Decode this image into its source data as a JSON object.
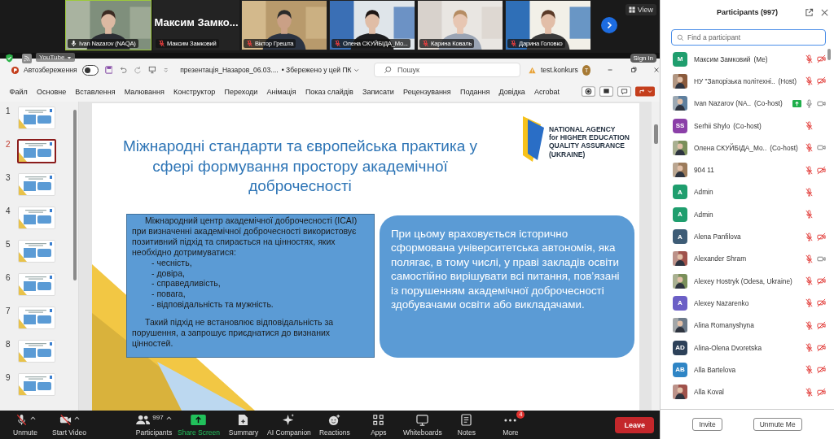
{
  "meeting_strip": {
    "tiles": [
      {
        "kind": "video",
        "name": "Ivan Nazarov (NAQA)",
        "muted": false,
        "active_speaker": true
      },
      {
        "kind": "name",
        "display_name": "Максим Замко...",
        "name": "Максим Замковий",
        "muted": true,
        "active_speaker": false
      },
      {
        "kind": "video",
        "name": "Віктор Грешта",
        "muted": true,
        "active_speaker": false
      },
      {
        "kind": "video",
        "name": "Олена СКУЙБІДА_Мо...",
        "muted": true,
        "active_speaker": false
      },
      {
        "kind": "video",
        "name": "Карина Коваль",
        "muted": true,
        "active_speaker": false
      },
      {
        "kind": "video",
        "name": "Дарина Головко",
        "muted": true,
        "active_speaker": false
      }
    ],
    "view_button": "View"
  },
  "browser_overlay": {
    "extension_chip": "YouTube",
    "sign_in": "Sign in"
  },
  "powerpoint": {
    "autosave_label": "Автозбереження",
    "autosave_on": false,
    "file_name": "презентація_Назаров_06.03....",
    "save_status": "• Збережено у цей ПК",
    "search_placeholder": "Пошук",
    "account": "test.konkurs",
    "account_initial": "T",
    "ribbon_tabs": [
      "Файл",
      "Основне",
      "Вставлення",
      "Малювання",
      "Конструктор",
      "Переходи",
      "Анімація",
      "Показ слайдів",
      "Записати",
      "Рецензування",
      "Подання",
      "Довідка",
      "Acrobat"
    ],
    "slides": [
      {
        "number": "1",
        "selected": false
      },
      {
        "number": "2",
        "selected": true
      },
      {
        "number": "3",
        "selected": false
      },
      {
        "number": "4",
        "selected": false
      },
      {
        "number": "5",
        "selected": false
      },
      {
        "number": "6",
        "selected": false
      },
      {
        "number": "7",
        "selected": false
      },
      {
        "number": "8",
        "selected": false
      },
      {
        "number": "9",
        "selected": false
      }
    ],
    "current_slide": {
      "title": "Міжнародні стандарти та європейська практика у сфері формування простору академічної доброчесності",
      "logo_lines": [
        "NATIONAL AGENCY",
        "for HIGHER EDUCATION",
        "QUALITY ASSURANCE",
        "(UKRAINE)"
      ],
      "left_box": {
        "paragraph": "Міжнародний центр академічної доброчесності (ICAI) при визначенні академічної доброчесності використовує позитивний підхід та спирається на цінностях, яких необхідно дотримуватися:",
        "bullets": [
          "- чесність,",
          "- довіра,",
          "- справедливість,",
          "- повага,",
          "- відповідальність та мужність."
        ],
        "closing": "Такий підхід не встановлює відповідальність за порушення, а запрошує приєднатися до визнаних цінностей."
      },
      "right_box": {
        "text": "При цьому враховується історично сформована університетська автономія, яка полягає, в тому числі, у праві закладів освіти самостійно вирішувати всі питання, пов’язані із порушенням академічної доброчесності здобувачами освіти або викладачами."
      }
    }
  },
  "participants": {
    "title": "Participants (997)",
    "search_placeholder": "Find a participant",
    "rows": [
      {
        "name": "Максим Замковий",
        "role": "(Me)",
        "avatar": {
          "kind": "initials",
          "text": "M",
          "color": "#1f9e6e"
        },
        "muted": true,
        "video_on": false,
        "sharing": false
      },
      {
        "name": "НУ \"Запорізька політехні..",
        "role": "(Host)",
        "muted": true,
        "video_on": false,
        "sharing": false
      },
      {
        "name": "Ivan Nazarov (NA..",
        "role": "(Co-host)",
        "muted": false,
        "video_on": true,
        "sharing": true
      },
      {
        "name": "Serhii Shylo",
        "role": "(Co-host)",
        "avatar": {
          "kind": "initials",
          "text": "SS",
          "color": "#8b3fa8"
        },
        "muted": true,
        "sharing": false
      },
      {
        "name": "Олена СКУЙБІДА_Мо..",
        "role": "(Co-host)",
        "muted": true,
        "video_on": true,
        "sharing": false
      },
      {
        "name": "904 11",
        "muted": true,
        "video_on": false,
        "sharing": false
      },
      {
        "name": "Admin",
        "avatar": {
          "kind": "initials",
          "text": "A",
          "color": "#1f9e6e"
        },
        "muted": true,
        "sharing": false
      },
      {
        "name": "Admin",
        "avatar": {
          "kind": "initials",
          "text": "A",
          "color": "#1f9e6e"
        },
        "muted": true,
        "sharing": false
      },
      {
        "name": "Alena Panfilova",
        "avatar": {
          "kind": "initials",
          "text": "A",
          "color": "#3e5c76"
        },
        "muted": true,
        "video_on": false,
        "sharing": false
      },
      {
        "name": "Alexander Shram",
        "muted": true,
        "video_on": true,
        "sharing": false
      },
      {
        "name": "Alexey Hostryk (Odesa, Ukraine)",
        "muted": true,
        "video_on": false,
        "sharing": false
      },
      {
        "name": "Alexey Nazarenko",
        "avatar": {
          "kind": "initials",
          "text": "A",
          "color": "#6b5fc6"
        },
        "muted": true,
        "video_on": false,
        "sharing": false
      },
      {
        "name": "Alina Romanyshyna",
        "muted": true,
        "video_on": false,
        "sharing": false
      },
      {
        "name": "Alina-Olena Dvoretska",
        "avatar": {
          "kind": "initials",
          "text": "AD",
          "color": "#2d4159"
        },
        "muted": true,
        "video_on": false,
        "sharing": false
      },
      {
        "name": "Alla Bartelova",
        "avatar": {
          "kind": "initials",
          "text": "AB",
          "color": "#2f85c5"
        },
        "muted": true,
        "video_on": false,
        "sharing": false
      },
      {
        "name": "Alla Koval",
        "muted": true,
        "video_on": false,
        "sharing": false
      }
    ],
    "buttons": [
      "Invite",
      "Unmute Me"
    ]
  },
  "toolbar": {
    "items": [
      {
        "kind": "microphone",
        "label": "Unmute",
        "caret": true
      },
      {
        "kind": "camera",
        "label": "Start Video",
        "caret": true
      },
      {
        "kind": "people",
        "label": "Participants",
        "count": "997",
        "caret": true
      },
      {
        "kind": "share",
        "label": "Share Screen"
      },
      {
        "kind": "summary",
        "label": "Summary"
      },
      {
        "kind": "sparkle",
        "label": "AI Companion"
      },
      {
        "kind": "smiley",
        "label": "Reactions"
      },
      {
        "kind": "apps",
        "label": "Apps"
      },
      {
        "kind": "whiteboard",
        "label": "Whiteboards"
      },
      {
        "kind": "notes",
        "label": "Notes"
      },
      {
        "kind": "dots",
        "label": "More",
        "badge": "4"
      }
    ],
    "leave_button": "Leave"
  }
}
